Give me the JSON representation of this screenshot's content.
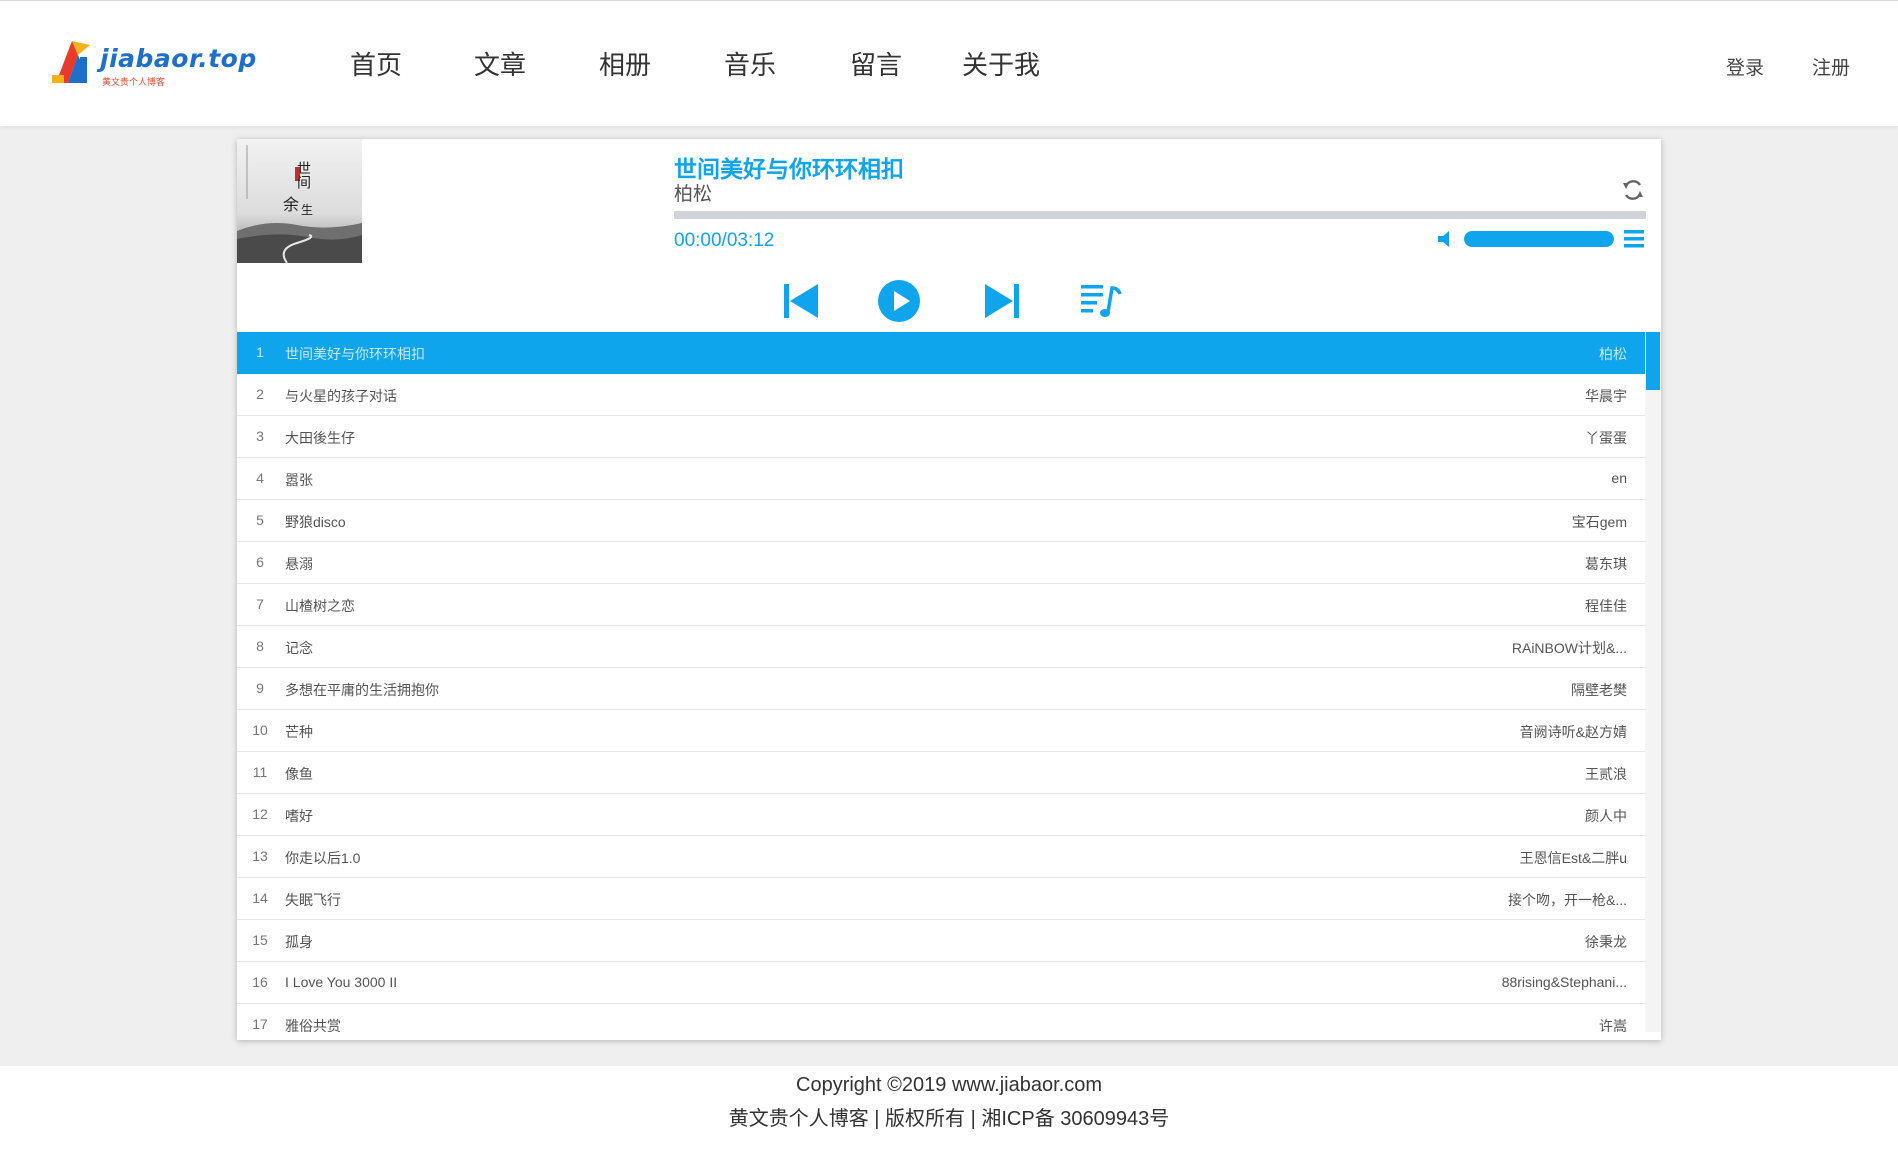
{
  "brand": {
    "logo_text": "jiabaor.top",
    "logo_subtitle": "黄文贵个人博客"
  },
  "nav": {
    "items": [
      "首页",
      "文章",
      "相册",
      "音乐",
      "留言",
      "关于我"
    ]
  },
  "auth": {
    "login": "登录",
    "register": "注册"
  },
  "player": {
    "cover_text_1": "世间",
    "cover_text_2": "余",
    "cover_text_3": "生",
    "title": "世间美好与你环环相扣",
    "artist": "柏松",
    "time": "00:00/03:12",
    "progress": 0,
    "volume": 1.0,
    "colors": {
      "accent": "#0ea5ed",
      "track": "#d2d2da"
    }
  },
  "playlist": [
    {
      "index": "1",
      "name": "世间美好与你环环相扣",
      "artist": "柏松",
      "active": true
    },
    {
      "index": "2",
      "name": "与火星的孩子对话",
      "artist": "华晨宇"
    },
    {
      "index": "3",
      "name": "大田後生仔",
      "artist": "丫蛋蛋"
    },
    {
      "index": "4",
      "name": "嚣张",
      "artist": "en"
    },
    {
      "index": "5",
      "name": "野狼disco",
      "artist": "宝石gem"
    },
    {
      "index": "6",
      "name": "悬溺",
      "artist": "葛东琪"
    },
    {
      "index": "7",
      "name": "山楂树之恋",
      "artist": "程佳佳"
    },
    {
      "index": "8",
      "name": "记念",
      "artist": "RAiNBOW计划&..."
    },
    {
      "index": "9",
      "name": "多想在平庸的生活拥抱你",
      "artist": "隔壁老樊"
    },
    {
      "index": "10",
      "name": "芒种",
      "artist": "音阙诗听&赵方婧"
    },
    {
      "index": "11",
      "name": "像鱼",
      "artist": "王贰浪"
    },
    {
      "index": "12",
      "name": "嗜好",
      "artist": "颜人中"
    },
    {
      "index": "13",
      "name": "你走以后1.0",
      "artist": "王恩信Est&二胖u"
    },
    {
      "index": "14",
      "name": "失眠飞行",
      "artist": "接个吻，开一枪&..."
    },
    {
      "index": "15",
      "name": "孤身",
      "artist": "徐秉龙"
    },
    {
      "index": "16",
      "name": "I Love You 3000 II",
      "artist": "88rising&Stephani..."
    },
    {
      "index": "17",
      "name": "雅俗共赏",
      "artist": "许嵩"
    }
  ],
  "footer": {
    "copyright": "Copyright ©2019  www.jiabaor.com",
    "info": "黄文贵个人博客 | 版权所有 | 湘ICP备 30609943号"
  },
  "icons": [
    "logo-icon",
    "loop-icon",
    "volume-icon",
    "list-menu-icon",
    "previous-icon",
    "play-icon",
    "next-icon",
    "playlist-icon"
  ]
}
